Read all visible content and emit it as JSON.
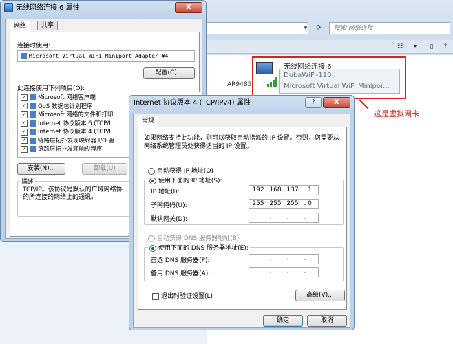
{
  "explorer": {
    "search_placeholder": "搜索 网络连接",
    "bg_item": "AR9485 WI...",
    "wifi_adapter": {
      "name": "无线网络连接 6",
      "ssid": "DubaWiFi-110",
      "device": "Microsoft Virtual WiFi Minipor..."
    },
    "annotation": "这是虚拟网卡"
  },
  "props_window": {
    "title": "无线网络连接 6 属性",
    "tabs": [
      "网络",
      "共享"
    ],
    "connect_using_label": "连接时使用:",
    "adapter": "Microsoft Virtual WiFi Miniport Adapter #4",
    "configure_button": "配置(C)...",
    "items_label": "此连接使用下列项目(O):",
    "items": [
      "Microsoft 网络客户端",
      "QoS 数据包计划程序",
      "Microsoft 网络的文件和打印",
      "Internet 协议版本 6 (TCP/I",
      "Internet 协议版本 4 (TCP/I",
      "链路层拓扑发现映射器 I/O 驱",
      "链路层拓扑发现响应程序"
    ],
    "install_button": "安装(N)...",
    "uninstall_button": "卸载(U)",
    "description_label": "描述",
    "description_text": "TCP/IP。该协议是默认的广域网络协 的所连接的网络上的通讯。"
  },
  "ipv4_window": {
    "title": "Internet 协议版本 4 (TCP/IPv4) 属性",
    "help_button": "?",
    "close_button": "X",
    "tab": "常规",
    "intro": "如果网络支持此功能，则可以获取自动指派的 IP 设置。否则，您需要从网络系统管理员处获得适当的 IP 设置。",
    "auto_ip": "自动获得 IP 地址(O)",
    "use_ip": "使用下面的 IP 地址(S):",
    "ip_label": "IP 地址(I):",
    "ip_value": [
      "192",
      "168",
      "137",
      "1"
    ],
    "mask_label": "子网掩码(U):",
    "mask_value": [
      "255",
      "255",
      "255",
      "0"
    ],
    "gateway_label": "默认网关(D):",
    "auto_dns": "自动获得 DNS 服务器地址(B)",
    "use_dns": "使用下面的 DNS 服务器地址(E):",
    "pref_dns_label": "首选 DNS 服务器(P):",
    "alt_dns_label": "备用 DNS 服务器(A):",
    "validate_label": "退出时验证设置(L)",
    "advanced_button": "高级(V)...",
    "ok_button": "确定",
    "cancel_button": "取消"
  }
}
